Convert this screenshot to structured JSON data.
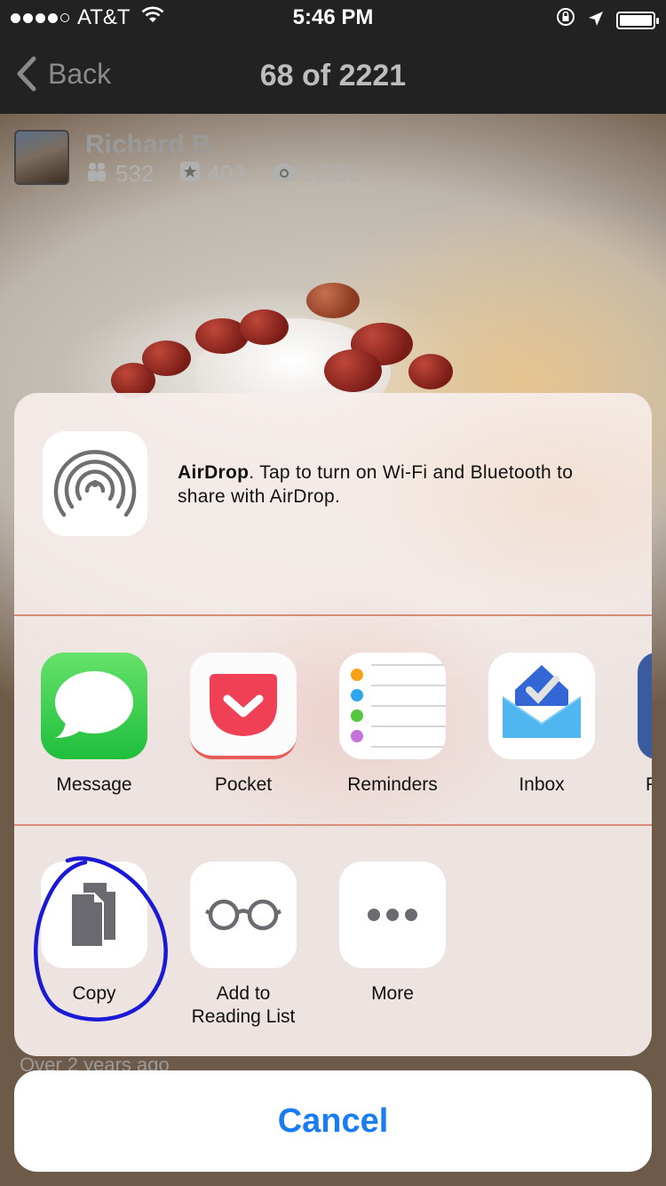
{
  "status_bar": {
    "carrier": "AT&T",
    "time": "5:46 PM",
    "signal_dots_filled": 4,
    "signal_dots_total": 5
  },
  "nav": {
    "back_label": "Back",
    "title": "68 of 2221"
  },
  "user": {
    "name": "Richard B.",
    "friends": "532",
    "reviews": "402",
    "photos": "1,500"
  },
  "photo_caption": "Over 2 years ago",
  "airdrop": {
    "title": "AirDrop",
    "message": ". Tap to turn on Wi-Fi and Bluetooth to share with AirDrop."
  },
  "share_apps": [
    {
      "label": "Message",
      "icon": "message-icon"
    },
    {
      "label": "Pocket",
      "icon": "pocket-icon"
    },
    {
      "label": "Reminders",
      "icon": "reminders-icon"
    },
    {
      "label": "Inbox",
      "icon": "inbox-icon"
    },
    {
      "label": "F",
      "icon": "facebook-icon"
    }
  ],
  "actions": [
    {
      "label": "Copy",
      "icon": "copy-icon"
    },
    {
      "label": "Add to\nReading List",
      "icon": "glasses-icon"
    },
    {
      "label": "More",
      "icon": "more-icon"
    }
  ],
  "cancel_label": "Cancel",
  "colors": {
    "accent": "#1a7cf2",
    "message_green": "#3ec74f",
    "pocket_red": "#ef4056",
    "inbox_blue": "#4285f4",
    "annotation_blue": "#1a1ad6"
  }
}
